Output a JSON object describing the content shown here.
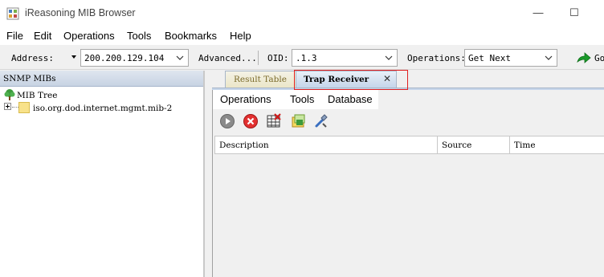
{
  "window": {
    "title": "iReasoning MIB Browser",
    "minimize": "—",
    "maximize": "☐"
  },
  "menubar": [
    "File",
    "Edit",
    "Operations",
    "Tools",
    "Bookmarks",
    "Help"
  ],
  "toolbar": {
    "address_label": "Address:",
    "address_value": "200.200.129.104",
    "advanced_label": "Advanced...",
    "oid_label": "OID:",
    "oid_value": ".1.3",
    "operations_label": "Operations:",
    "operations_value": "Get Next",
    "go_label": "Go"
  },
  "left_panel": {
    "header": "SNMP MIBs",
    "tree_root": "MIB Tree",
    "tree_child": "iso.org.dod.internet.mgmt.mib-2"
  },
  "tabs": [
    {
      "label": "Result Table"
    },
    {
      "label": "Trap Receiver",
      "close": "✕"
    }
  ],
  "trap_receiver": {
    "menu": [
      "Operations",
      "Tools",
      "Database"
    ],
    "icons": [
      "start-icon",
      "stop-icon",
      "clear-table-icon",
      "trap-settings-icon",
      "tools-icon"
    ],
    "columns": [
      "Description",
      "Source",
      "Time"
    ]
  },
  "colors": {
    "highlight": "#e02020",
    "tab_active": "#c5d5ea",
    "go_arrow": "#1a9a2a"
  }
}
